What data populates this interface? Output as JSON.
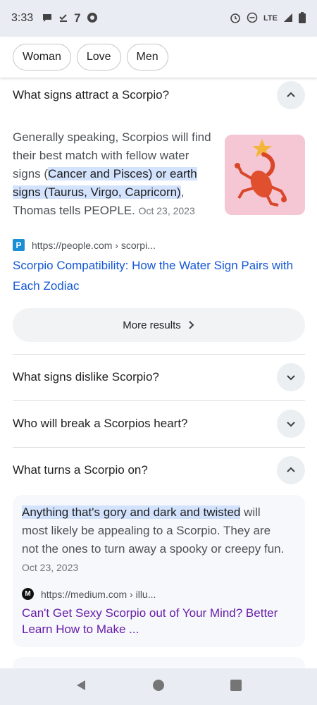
{
  "status_bar": {
    "time": "3:33",
    "network": "LTE",
    "left_icons": [
      "chat-icon",
      "checkmark-download-icon",
      "seven-icon",
      "assistant-icon"
    ],
    "right_icons": [
      "alarm-icon",
      "dnd-icon",
      "signal-icon",
      "battery-icon"
    ]
  },
  "chips": [
    "Woman",
    "Love",
    "Men"
  ],
  "questions": [
    {
      "question": "What signs attract a Scorpio?",
      "expanded": true,
      "answer_pre": "Generally speaking, Scorpios will find their best match with fellow water signs (",
      "answer_highlight": "Cancer and Pisces) or earth signs (Taurus, Virgo, Capricorn)",
      "answer_post": ", Thomas tells PEOPLE.",
      "date": "Oct 23, 2023",
      "source_favicon": "P",
      "source_url": "https://people.com › scorpi...",
      "link_title": "Scorpio Compatibility: How the Water Sign Pairs with Each Zodiac"
    },
    {
      "question": "What signs dislike Scorpio?",
      "expanded": false
    },
    {
      "question": "Who will break a Scorpios heart?",
      "expanded": false
    },
    {
      "question": "What turns a Scorpio on?",
      "expanded": true,
      "answer_highlight": "Anything that's gory and dark and twisted",
      "answer_post": " will most likely be appealing to a Scorpio. They are not the ones to turn away a spooky or creepy fun.",
      "date": "Oct 23, 2023",
      "source_favicon": "M",
      "source_url": "https://medium.com › illu...",
      "link_title": "Can't Get Sexy Scorpio out of Your Mind? Better Learn How to Make ..."
    }
  ],
  "more_results_label": "More results",
  "colors": {
    "link": "#1558d6",
    "visited_link": "#681da8",
    "highlight": "#d3e3fd",
    "thumbnail_bg": "#f5c6d3"
  }
}
